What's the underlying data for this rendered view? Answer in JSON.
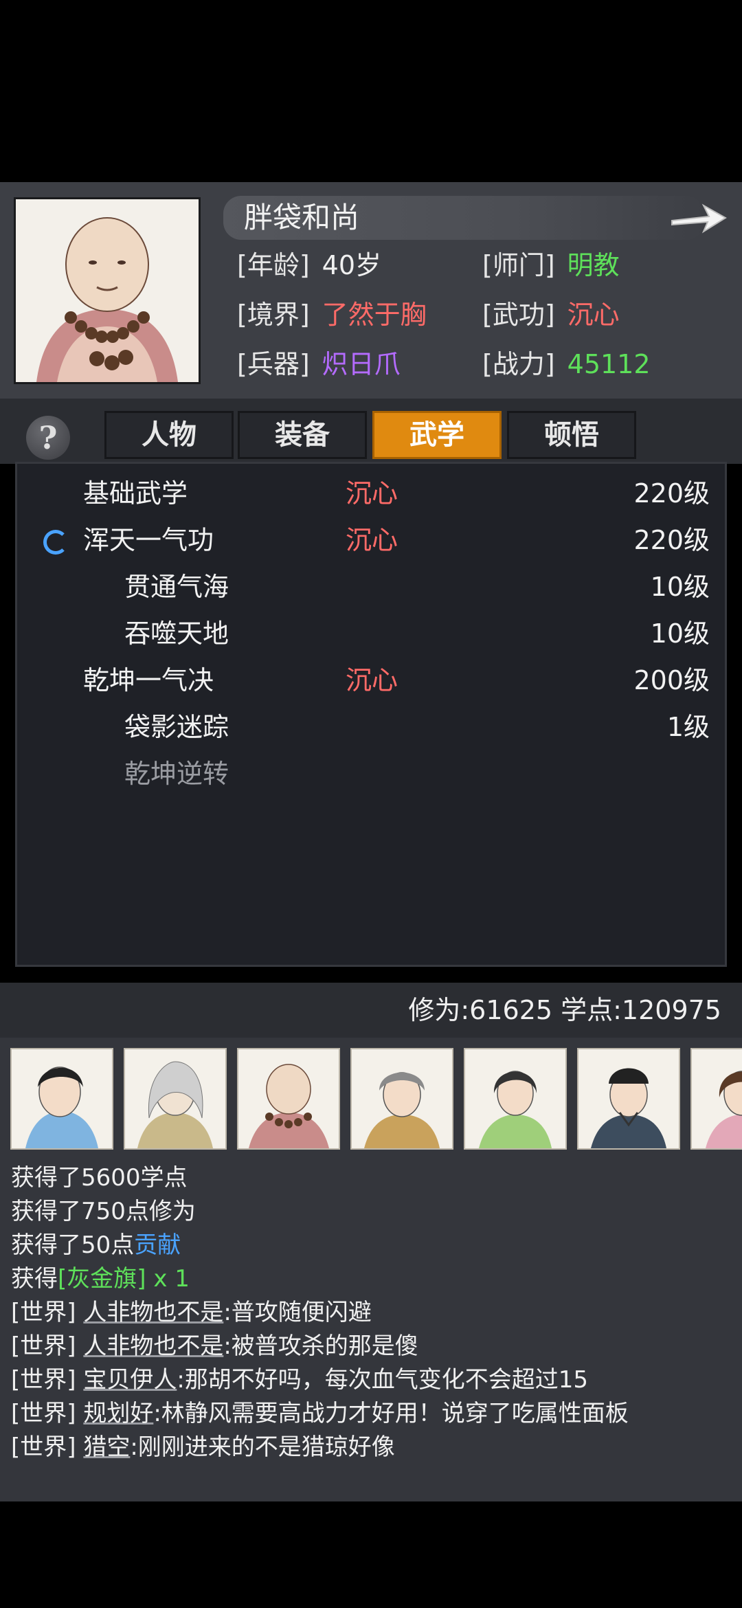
{
  "character": {
    "name": "胖袋和尚",
    "stats": [
      {
        "key": "[年龄]",
        "value": "40岁",
        "color": "white"
      },
      {
        "key": "[师门]",
        "value": "明教",
        "color": "green"
      },
      {
        "key": "[境界]",
        "value": "了然于胸",
        "color": "red"
      },
      {
        "key": "[武功]",
        "value": "沉心",
        "color": "red"
      },
      {
        "key": "[兵器]",
        "value": "炽日爪",
        "color": "purple"
      },
      {
        "key": "[战力]",
        "value": "45112",
        "color": "green"
      }
    ]
  },
  "tabs": [
    {
      "label": "人物",
      "active": false
    },
    {
      "label": "装备",
      "active": false
    },
    {
      "label": "武学",
      "active": true
    },
    {
      "label": "顿悟",
      "active": false
    }
  ],
  "help_label": "?",
  "martial_arts": [
    {
      "name": "基础武学",
      "skill": "沉心",
      "level": "220级",
      "indent": false,
      "dim": false,
      "loading": false
    },
    {
      "name": "浑天一气功",
      "skill": "沉心",
      "level": "220级",
      "indent": false,
      "dim": false,
      "loading": true
    },
    {
      "name": "贯通气海",
      "skill": "",
      "level": "10级",
      "indent": true,
      "dim": false,
      "loading": false
    },
    {
      "name": "吞噬天地",
      "skill": "",
      "level": "10级",
      "indent": true,
      "dim": false,
      "loading": false
    },
    {
      "name": "乾坤一气决",
      "skill": "沉心",
      "level": "200级",
      "indent": false,
      "dim": false,
      "loading": false
    },
    {
      "name": "袋影迷踪",
      "skill": "",
      "level": "1级",
      "indent": true,
      "dim": false,
      "loading": false
    },
    {
      "name": "乾坤逆转",
      "skill": "",
      "level": "",
      "indent": true,
      "dim": true,
      "loading": false
    }
  ],
  "stats_bar": {
    "text": "修为:61625  学点:120975"
  },
  "avatars": [
    "avatar-1",
    "avatar-2",
    "avatar-3",
    "avatar-4",
    "avatar-5",
    "avatar-6",
    "avatar-7"
  ],
  "chat": [
    {
      "segments": [
        {
          "t": "获得了5600学点"
        }
      ]
    },
    {
      "segments": [
        {
          "t": "获得了750点修为"
        }
      ]
    },
    {
      "segments": [
        {
          "t": "获得了50点"
        },
        {
          "t": "贡献",
          "c": "blue"
        }
      ]
    },
    {
      "segments": [
        {
          "t": "获得"
        },
        {
          "t": "[灰金旗] x 1",
          "c": "green"
        }
      ]
    },
    {
      "segments": [
        {
          "t": "[世界] "
        },
        {
          "t": "人非物也不是",
          "c": "user"
        },
        {
          "t": ":普攻随便闪避"
        }
      ]
    },
    {
      "segments": [
        {
          "t": "[世界] "
        },
        {
          "t": "人非物也不是",
          "c": "user"
        },
        {
          "t": ":被普攻杀的那是傻"
        }
      ]
    },
    {
      "segments": [
        {
          "t": "[世界] "
        },
        {
          "t": "宝贝伊人",
          "c": "user"
        },
        {
          "t": ":那胡不好吗，每次血气变化不会超过15"
        }
      ]
    },
    {
      "segments": [
        {
          "t": "[世界] "
        },
        {
          "t": "规划好",
          "c": "user"
        },
        {
          "t": ":林静风需要高战力才好用！说穿了吃属性面板"
        }
      ]
    },
    {
      "segments": [
        {
          "t": "[世界] "
        },
        {
          "t": "猎空",
          "c": "user"
        },
        {
          "t": ":刚刚进来的不是猎琼好像"
        }
      ]
    }
  ]
}
